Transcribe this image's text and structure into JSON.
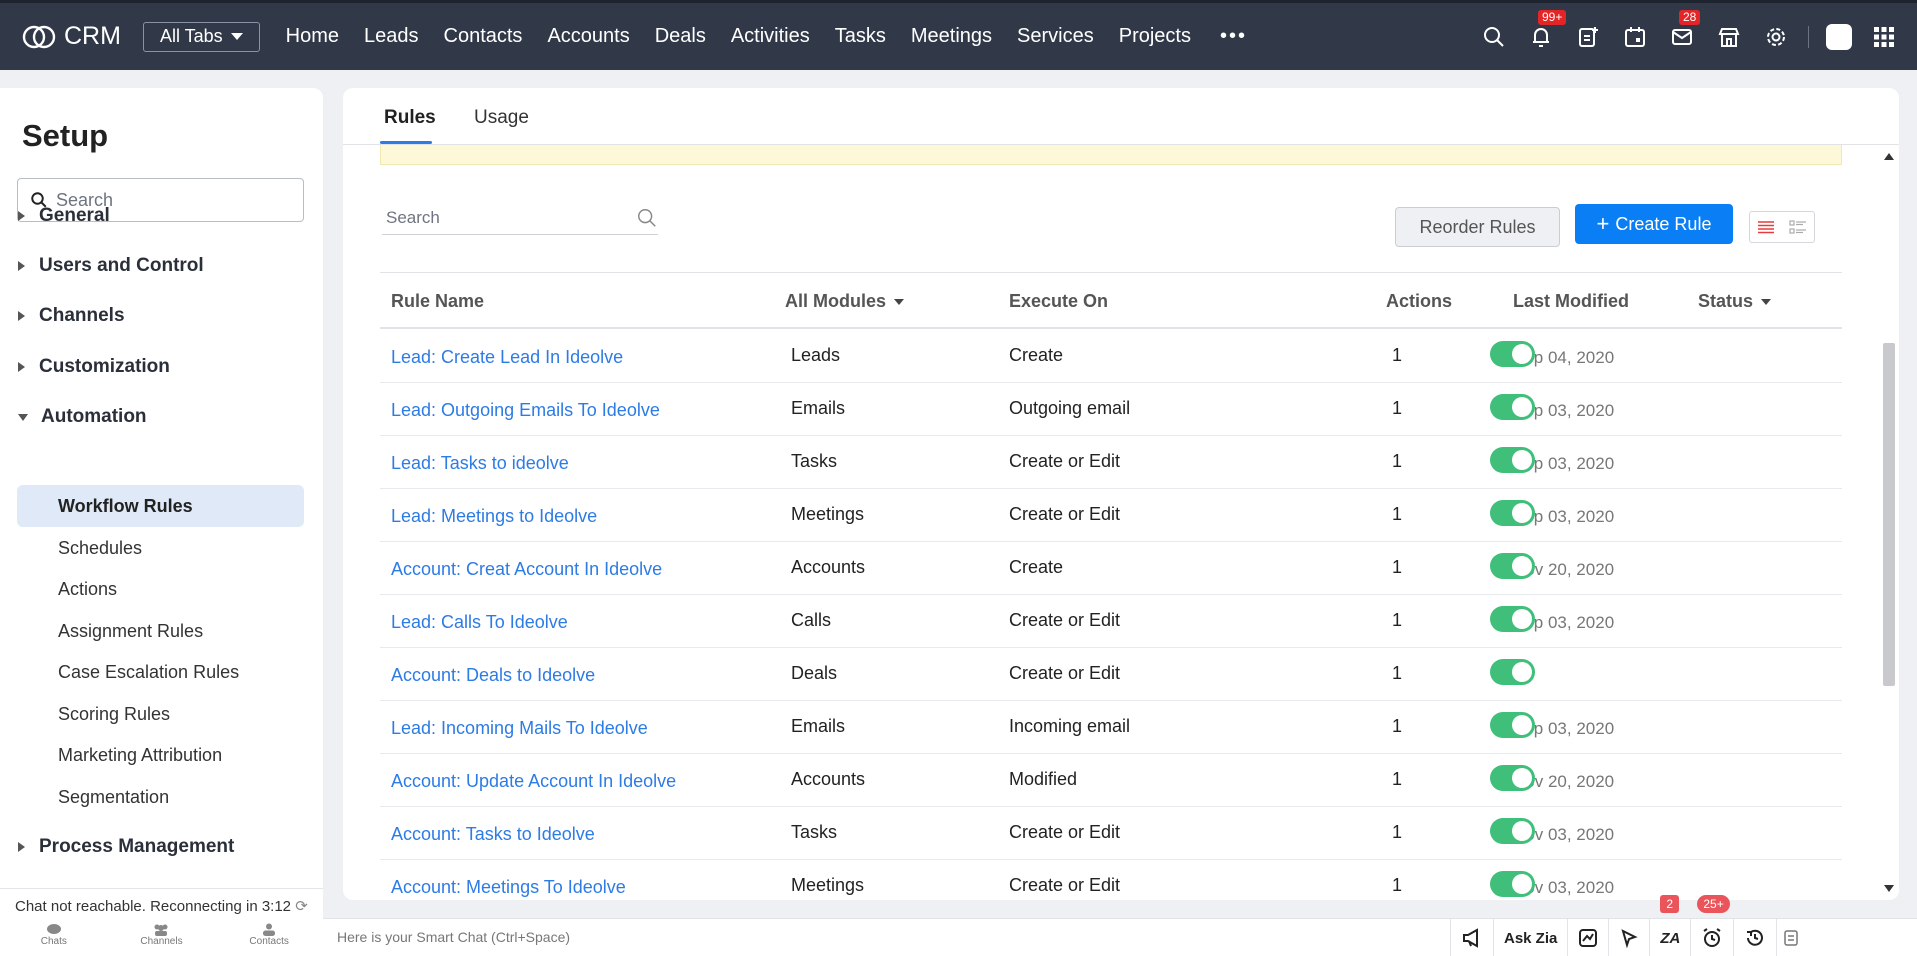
{
  "topbar": {
    "app_name": "CRM",
    "all_tabs_label": "All Tabs",
    "nav": [
      "Home",
      "Leads",
      "Contacts",
      "Accounts",
      "Deals",
      "Activities",
      "Tasks",
      "Meetings",
      "Services",
      "Projects"
    ],
    "more_label": "•••",
    "notifications_badge": "99+",
    "mail_badge": "28"
  },
  "sidebar": {
    "title": "Setup",
    "search_placeholder": "Search",
    "groups": {
      "general": "General",
      "users": "Users and Control",
      "channels": "Channels",
      "customization": "Customization",
      "automation": "Automation",
      "process": "Process Management"
    },
    "automation_items": [
      "Workflow Rules",
      "Schedules",
      "Actions",
      "Assignment Rules",
      "Case Escalation Rules",
      "Scoring Rules",
      "Marketing Attribution",
      "Segmentation"
    ]
  },
  "chat": {
    "status": "Chat not reachable. Reconnecting in 3:12",
    "tabs": [
      "Chats",
      "Channels",
      "Contacts"
    ]
  },
  "main": {
    "tabs": [
      "Rules",
      "Usage"
    ],
    "search_placeholder": "Search",
    "reorder_label": "Reorder Rules",
    "create_label": "Create Rule",
    "columns": [
      "Rule Name",
      "All Modules",
      "Execute On",
      "Actions",
      "Last Modified",
      "Status"
    ],
    "rows": [
      {
        "name": "Lead: Create Lead In Ideolve",
        "module": "Leads",
        "execute": "Create",
        "actions": "1",
        "modified": "Sep 04, 2020"
      },
      {
        "name": "Lead: Outgoing Emails To Ideolve",
        "module": "Emails",
        "execute": "Outgoing email",
        "actions": "1",
        "modified": "Sep 03, 2020"
      },
      {
        "name": "Lead: Tasks to ideolve",
        "module": "Tasks",
        "execute": "Create or Edit",
        "actions": "1",
        "modified": "Sep 03, 2020"
      },
      {
        "name": "Lead: Meetings to Ideolve",
        "module": "Meetings",
        "execute": "Create or Edit",
        "actions": "1",
        "modified": "Sep 03, 2020"
      },
      {
        "name": "Account: Creat Account In Ideolve",
        "module": "Accounts",
        "execute": "Create",
        "actions": "1",
        "modified": "Nov 20, 2020"
      },
      {
        "name": "Lead: Calls To Ideolve",
        "module": "Calls",
        "execute": "Create or Edit",
        "actions": "1",
        "modified": "Sep 03, 2020"
      },
      {
        "name": "Account: Deals to Ideolve",
        "module": "Deals",
        "execute": "Create or Edit",
        "actions": "1",
        "modified": ""
      },
      {
        "name": "Lead: Incoming Mails To Ideolve",
        "module": "Emails",
        "execute": "Incoming email",
        "actions": "1",
        "modified": "Sep 03, 2020"
      },
      {
        "name": "Account: Update Account In Ideolve",
        "module": "Accounts",
        "execute": "Modified",
        "actions": "1",
        "modified": "Nov 20, 2020"
      },
      {
        "name": "Account: Tasks to Ideolve",
        "module": "Tasks",
        "execute": "Create or Edit",
        "actions": "1",
        "modified": "Nov 03, 2020"
      },
      {
        "name": "Account: Meetings To Ideolve",
        "module": "Meetings",
        "execute": "Create or Edit",
        "actions": "1",
        "modified": "Nov 03, 2020"
      }
    ]
  },
  "bottombar": {
    "smart_chat_placeholder": "Here is your Smart Chat (Ctrl+Space)",
    "ask_zia": "Ask Zia",
    "badge_a": "2",
    "badge_b": "25+"
  },
  "colors": {
    "topbar": "#313949",
    "accent": "#0a7ff5",
    "link": "#2d7be5",
    "toggle_on": "#3fbf79"
  }
}
